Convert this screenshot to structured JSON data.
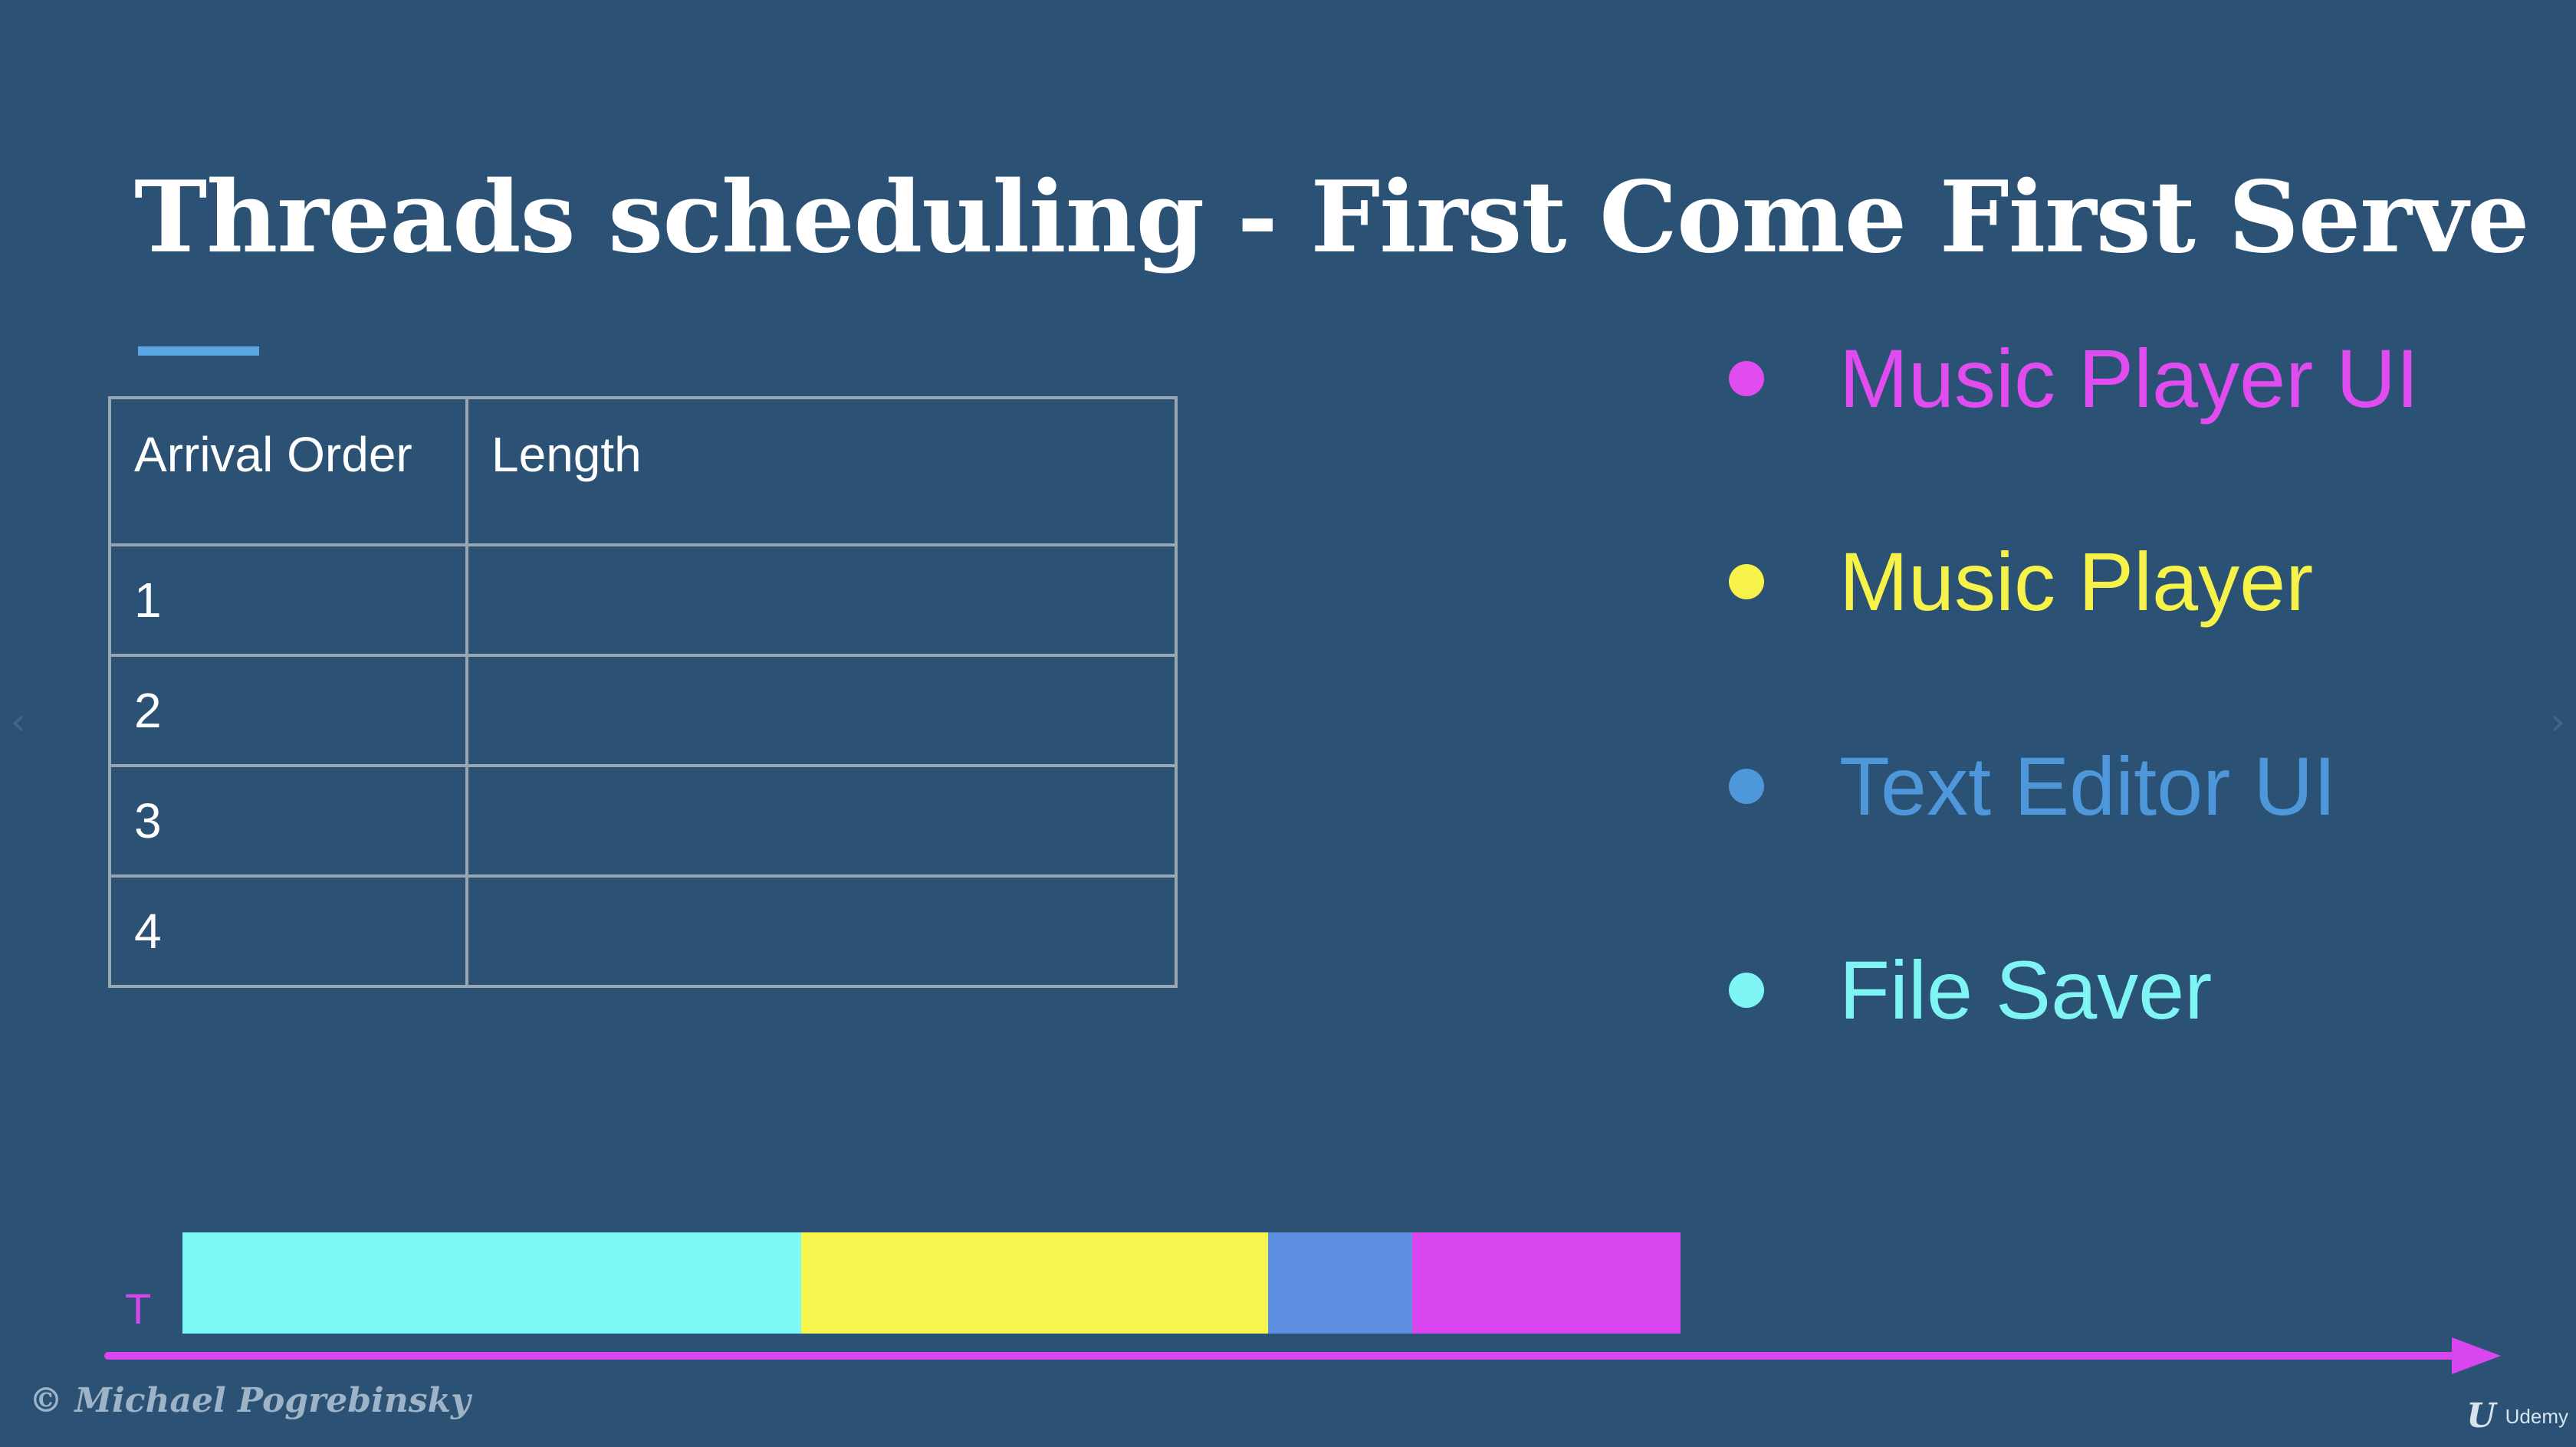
{
  "slide": {
    "title": "Threads scheduling - First Come First Serve",
    "colors": {
      "background": "#2b5275",
      "accent_underline": "#5aa7e3",
      "axis": "#d946ef"
    }
  },
  "table": {
    "headers": [
      "Arrival Order",
      "Length"
    ],
    "rows": [
      {
        "order": "1",
        "length": ""
      },
      {
        "order": "2",
        "length": ""
      },
      {
        "order": "3",
        "length": ""
      },
      {
        "order": "4",
        "length": ""
      }
    ]
  },
  "legend": {
    "items": [
      {
        "label": "Music Player UI",
        "color": "#e04cf0"
      },
      {
        "label": "Music Player",
        "color": "#f6f24a"
      },
      {
        "label": "Text Editor UI",
        "color": "#4f97db"
      },
      {
        "label": "File Saver",
        "color": "#7ef4f4"
      }
    ]
  },
  "timeline": {
    "axis_label": "T",
    "axis_label_color": "#d946ef",
    "segments": [
      {
        "thread": "File Saver",
        "start": 0,
        "duration": 4.17,
        "color": "#7ef7f7"
      },
      {
        "thread": "Music Player",
        "start": 4.17,
        "duration": 3.15,
        "color": "#f8f54e"
      },
      {
        "thread": "Text Editor UI",
        "start": 7.32,
        "duration": 0.97,
        "color": "#5e8ee0"
      },
      {
        "thread": "Music Player UI",
        "start": 8.29,
        "duration": 1.81,
        "color": "#d946ef"
      }
    ]
  },
  "footer": {
    "copyright": "© Michael Pogrebinsky",
    "brand_mark": "U",
    "brand_name": "Udemy",
    "nav_prev": "‹",
    "nav_next": "›"
  }
}
